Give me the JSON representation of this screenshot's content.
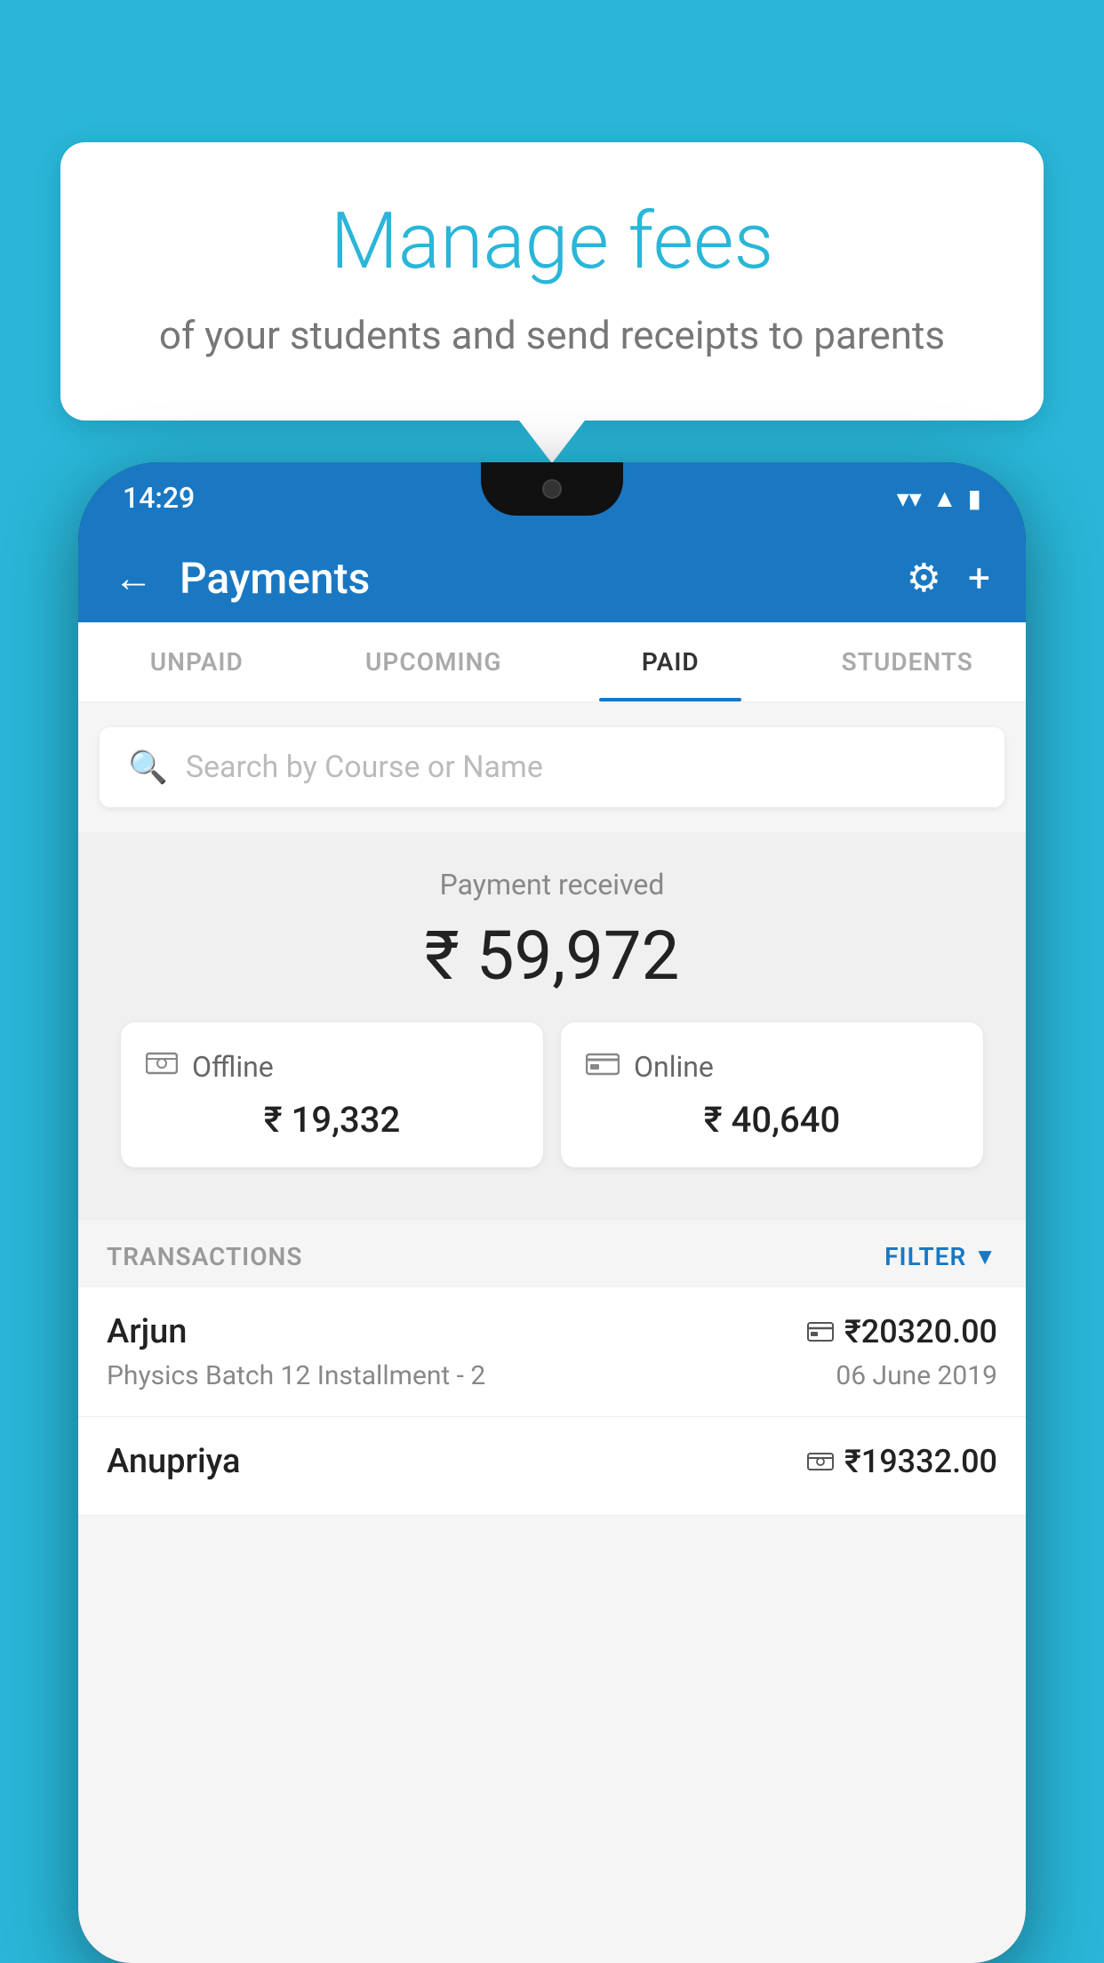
{
  "background_color": "#29b6d8",
  "speech_bubble": {
    "title": "Manage fees",
    "subtitle": "of your students and send receipts to parents"
  },
  "phone": {
    "status_bar": {
      "time": "14:29",
      "icons": [
        "wifi",
        "signal",
        "battery"
      ]
    },
    "app_bar": {
      "title": "Payments",
      "back_label": "←",
      "settings_icon": "⚙",
      "add_icon": "+"
    },
    "tabs": [
      {
        "label": "UNPAID",
        "active": false
      },
      {
        "label": "UPCOMING",
        "active": false
      },
      {
        "label": "PAID",
        "active": true
      },
      {
        "label": "STUDENTS",
        "active": false
      }
    ],
    "search": {
      "placeholder": "Search by Course or Name"
    },
    "payment_section": {
      "label": "Payment received",
      "total_amount": "₹ 59,972",
      "offline": {
        "label": "Offline",
        "amount": "₹ 19,332"
      },
      "online": {
        "label": "Online",
        "amount": "₹ 40,640"
      }
    },
    "transactions": {
      "header_label": "TRANSACTIONS",
      "filter_label": "FILTER",
      "items": [
        {
          "name": "Arjun",
          "amount": "₹20320.00",
          "course": "Physics Batch 12 Installment - 2",
          "date": "06 June 2019",
          "payment_type": "card"
        },
        {
          "name": "Anupriya",
          "amount": "₹19332.00",
          "course": "",
          "date": "",
          "payment_type": "cash"
        }
      ]
    }
  }
}
